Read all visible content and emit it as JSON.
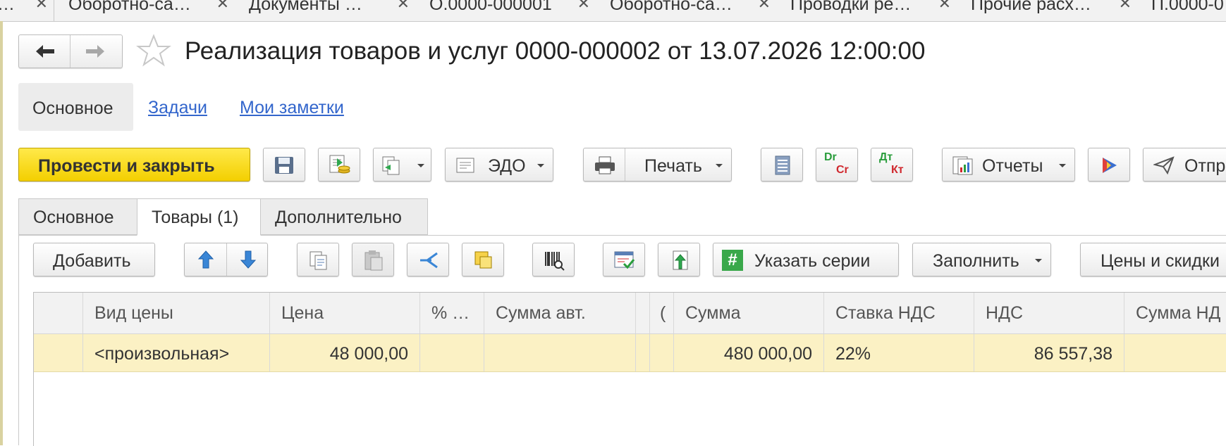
{
  "window_tabs": [
    {
      "label": "…"
    },
    {
      "label": "Оборотно-са…"
    },
    {
      "label": "Документы …"
    },
    {
      "label": "О.0000-000001"
    },
    {
      "label": "Оборотно-са…"
    },
    {
      "label": "Проводки ре…"
    },
    {
      "label": "Прочие расх…"
    },
    {
      "label": "П.0000-0"
    }
  ],
  "header": {
    "title": "Реализация товаров и услуг 0000-000002 от 13.07.2026 12:00:00"
  },
  "sections": {
    "main": "Основное",
    "tasks": "Задачи",
    "notes": "Мои заметки"
  },
  "toolbar": {
    "post_close": "Провести и закрыть",
    "edo": "ЭДО",
    "print": "Печать",
    "dr": "Dr",
    "cr": "Cr",
    "dt": "Дт",
    "kt": "Кт",
    "reports": "Отчеты",
    "send": "Отпр"
  },
  "form_tabs": [
    {
      "label": "Основное"
    },
    {
      "label": "Товары (1)"
    },
    {
      "label": "Дополнительно"
    }
  ],
  "table_toolbar": {
    "add": "Добавить",
    "series": "Указать серии",
    "series_hash": "#",
    "fill": "Заполнить",
    "prices": "Цены и скидки"
  },
  "table": {
    "columns": [
      "Вид цены",
      "Цена",
      "% …",
      "Сумма авт.",
      "(",
      "Сумма",
      "Ставка НДС",
      "НДС",
      "Сумма НД"
    ],
    "rows": [
      {
        "price_type": "<произвольная>",
        "price": "48 000,00",
        "percent": "",
        "auto_sum": "",
        "sum": "480 000,00",
        "vat_rate": "22%",
        "vat": "86 557,38",
        "sum_vat": ""
      }
    ]
  },
  "colors": {
    "primary_button": "#f3cf00",
    "row_highlight": "#fbf1c4",
    "link": "#3366cc"
  }
}
